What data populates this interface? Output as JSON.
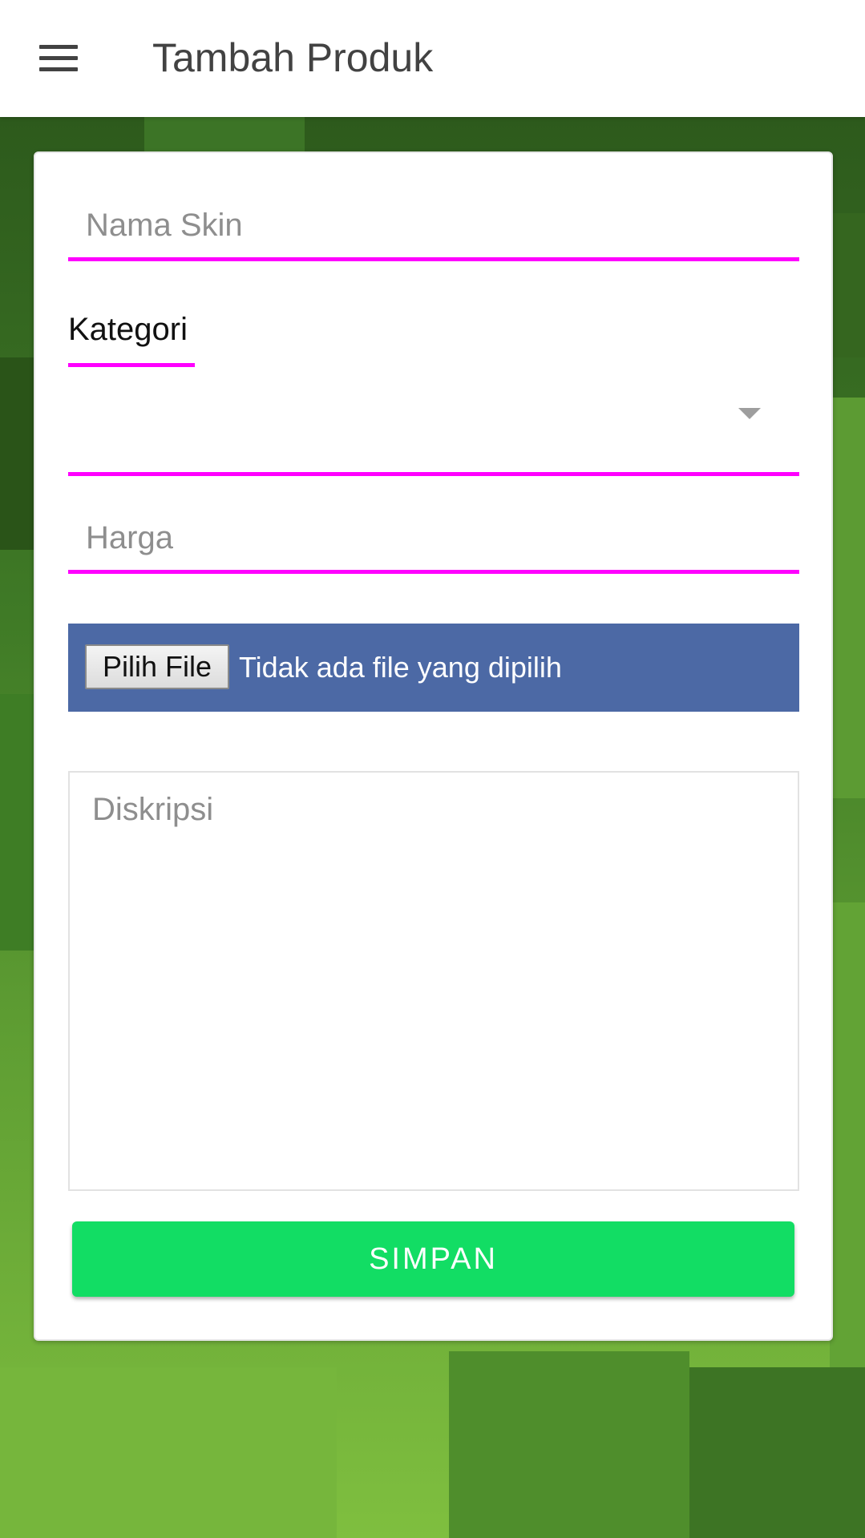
{
  "header": {
    "title": "Tambah Produk",
    "menu_icon": "hamburger-menu-icon"
  },
  "form": {
    "name_field": {
      "placeholder": "Nama Skin",
      "value": ""
    },
    "category": {
      "label": "Kategori",
      "selected": "",
      "dropdown_icon": "caret-down-icon"
    },
    "price_field": {
      "placeholder": "Harga",
      "value": ""
    },
    "file_upload": {
      "button_label": "Pilih File",
      "status_text": "Tidak ada file yang dipilih"
    },
    "description": {
      "placeholder": "Diskripsi",
      "value": ""
    },
    "save_button": {
      "label": "SIMPAN"
    }
  },
  "colors": {
    "accent_underline": "#ff00ff",
    "file_box": "#4c69a5",
    "save_button": "#12dd64",
    "background": "#4a8a2a"
  }
}
